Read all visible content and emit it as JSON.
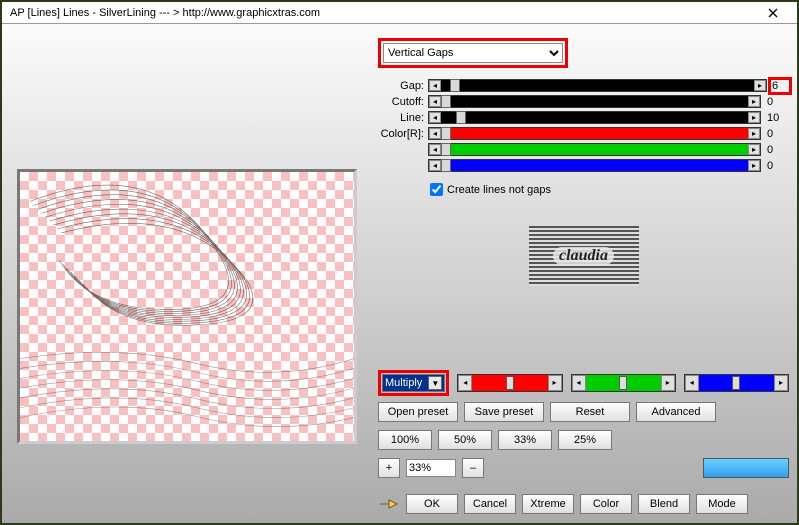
{
  "window": {
    "title": "AP [Lines]  Lines - SilverLining    --- >  http://www.graphicxtras.com"
  },
  "top_dropdown": {
    "selected": "Vertical Gaps",
    "options": [
      "Vertical Gaps"
    ]
  },
  "sliders": [
    {
      "label": "Gap:",
      "value": "6",
      "thumb_pct": 3,
      "kind": "plain",
      "hl": true
    },
    {
      "label": "Cutoff:",
      "value": "0",
      "thumb_pct": 0,
      "kind": "plain",
      "hl": false
    },
    {
      "label": "Line:",
      "value": "10",
      "thumb_pct": 5,
      "kind": "plain",
      "hl": false
    },
    {
      "label": "Color[R]:",
      "value": "0",
      "thumb_pct": 0,
      "kind": "red",
      "hl": false
    },
    {
      "label": "",
      "value": "0",
      "thumb_pct": 0,
      "kind": "green",
      "hl": false
    },
    {
      "label": "",
      "value": "0",
      "thumb_pct": 0,
      "kind": "blue",
      "hl": false
    }
  ],
  "checkbox": {
    "label": "Create lines not gaps",
    "checked": true
  },
  "logo_text": "claudia",
  "blend_mode": {
    "selected": "Multiply"
  },
  "rgb_bottom": [
    "red",
    "green",
    "blue"
  ],
  "buttons": {
    "row1": [
      "Open preset",
      "Save preset",
      "Reset",
      "Advanced"
    ],
    "row2": [
      "100%",
      "50%",
      "33%",
      "25%"
    ],
    "zoom": {
      "plus": "+",
      "minus": "–",
      "value": "33%"
    },
    "row4": [
      "OK",
      "Cancel",
      "Xtreme",
      "Color",
      "Blend",
      "Mode"
    ]
  }
}
